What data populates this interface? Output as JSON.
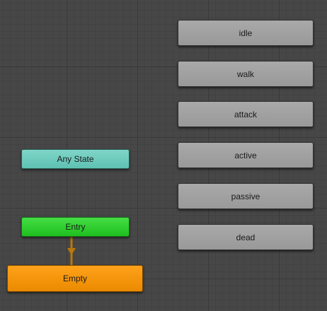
{
  "window": {
    "title": ""
  },
  "graph": {
    "states": [
      {
        "label": "idle"
      },
      {
        "label": "walk"
      },
      {
        "label": "attack"
      },
      {
        "label": "active"
      },
      {
        "label": "passive"
      },
      {
        "label": "dead"
      }
    ],
    "any_state": {
      "label": "Any State"
    },
    "entry": {
      "label": "Entry"
    },
    "default_state": {
      "label": "Empty"
    }
  },
  "colors": {
    "grid_background": "#474747",
    "state_node": "#a3a3a3",
    "any_state_node": "#6fcfc0",
    "entry_node": "#2fd12f",
    "default_state_node": "#f89511",
    "transition_arrow": "#b8780a"
  }
}
